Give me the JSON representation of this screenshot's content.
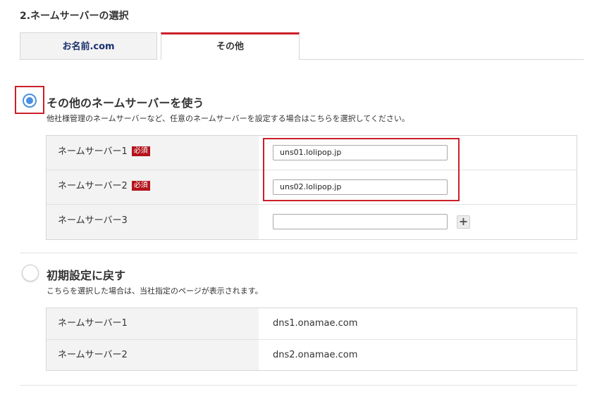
{
  "section_title": "2.ネームサーバーの選択",
  "tabs": [
    {
      "label": "お名前.com",
      "active": false
    },
    {
      "label": "その他",
      "active": true
    }
  ],
  "option_other": {
    "title": "その他のネームサーバーを使う",
    "description": "他社様管理のネームサーバーなど、任意のネームサーバーを設定する場合はこちらを選択してください。",
    "selected": true,
    "rows": [
      {
        "label": "ネームサーバー1",
        "required_badge": "必須",
        "value": "uns01.lolipop.jp"
      },
      {
        "label": "ネームサーバー2",
        "required_badge": "必須",
        "value": "uns02.lolipop.jp"
      },
      {
        "label": "ネームサーバー3",
        "value": "",
        "add_button": "+"
      }
    ]
  },
  "option_default": {
    "title": "初期設定に戻す",
    "description": "こちらを選択した場合は、当社指定のページが表示されます。",
    "selected": false,
    "rows": [
      {
        "label": "ネームサーバー1",
        "value": "dns1.onamae.com"
      },
      {
        "label": "ネームサーバー2",
        "value": "dns2.onamae.com"
      }
    ]
  },
  "colors": {
    "accent_red": "#cc1f28",
    "radio_blue": "#4a90e2",
    "required_bg": "#b3141b",
    "tab_text_blue": "#1a2f6e"
  }
}
